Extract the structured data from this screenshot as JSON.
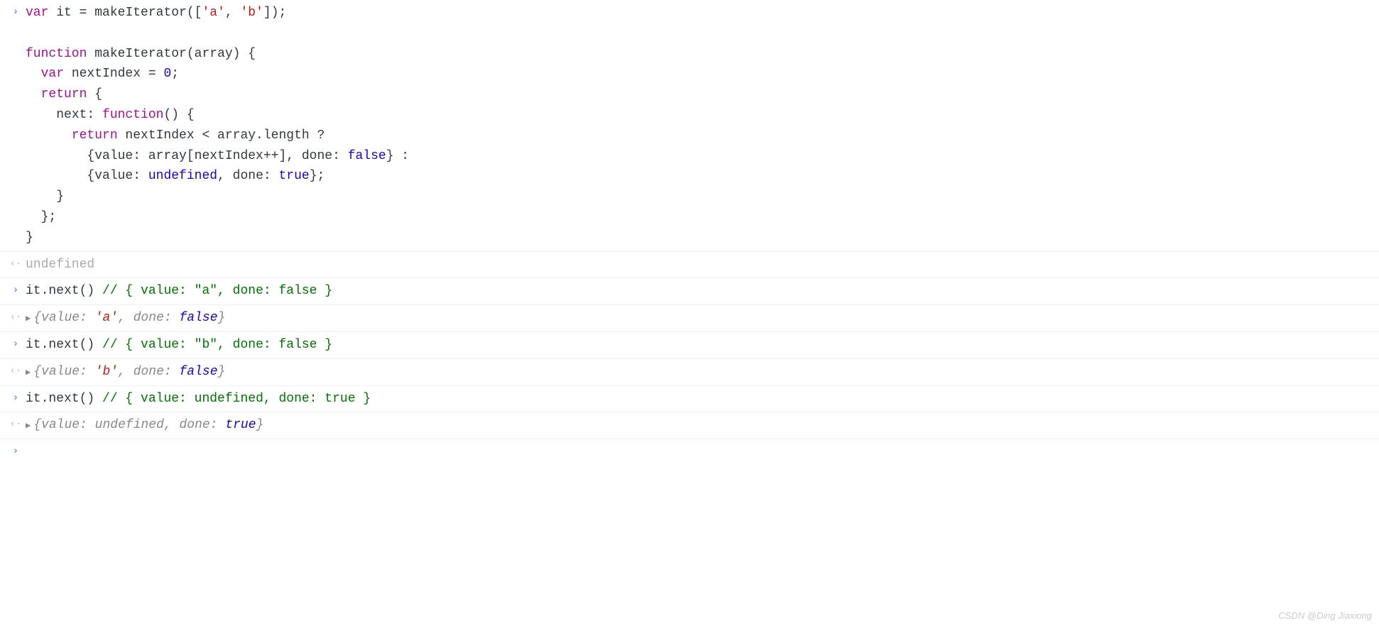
{
  "gutter": {
    "in": "›",
    "out": "‹·"
  },
  "expand_marker": "▶",
  "code_block": {
    "l1_var": "var",
    "l1_it": " it ",
    "l1_eq": "= ",
    "l1_make": "makeIterator",
    "l1_paren_open": "([",
    "l1_a": "'a'",
    "l1_comma": ", ",
    "l1_b": "'b'",
    "l1_paren_close": "]);",
    "blank": "",
    "l3_function": "function",
    "l3_name": " makeIterator",
    "l3_params": "(array) {",
    "l4_indent": "  ",
    "l4_var": "var",
    "l4_rest": " nextIndex = ",
    "l4_zero": "0",
    "l4_semi": ";",
    "l5_indent": "  ",
    "l5_return": "return",
    "l5_rest": " {",
    "l6_indent": "    ",
    "l6_next": "next: ",
    "l6_function": "function",
    "l6_rest": "() {",
    "l7_indent": "      ",
    "l7_return": "return",
    "l7_rest": " nextIndex < array.length ?",
    "l8_indent": "        ",
    "l8_text": "{value: array[nextIndex++], done: ",
    "l8_false": "false",
    "l8_end": "} :",
    "l9_indent": "        ",
    "l9_text": "{value: ",
    "l9_undef": "undefined",
    "l9_mid": ", done: ",
    "l9_true": "true",
    "l9_end": "};",
    "l10": "    }",
    "l11": "  };",
    "l12": "}"
  },
  "out_undefined": "undefined",
  "inputs": {
    "call1": "it.next() ",
    "comment1": "// { value: \"a\", done: false }",
    "call2": "it.next() ",
    "comment2": "// { value: \"b\", done: false }",
    "call3": "it.next() ",
    "comment3": "// { value: undefined, done: true }"
  },
  "outputs": {
    "o1_open": "{",
    "o1_k1": "value: ",
    "o1_v1": "'a'",
    "o1_sep": ", ",
    "o1_k2": "done: ",
    "o1_v2": "false",
    "o1_close": "}",
    "o2_open": "{",
    "o2_k1": "value: ",
    "o2_v1": "'b'",
    "o2_sep": ", ",
    "o2_k2": "done: ",
    "o2_v2": "false",
    "o2_close": "}",
    "o3_open": "{",
    "o3_k1": "value: ",
    "o3_v1": "undefined",
    "o3_sep": ", ",
    "o3_k2": "done: ",
    "o3_v2": "true",
    "o3_close": "}"
  },
  "watermark": "CSDN @Ding Jiaxiong"
}
